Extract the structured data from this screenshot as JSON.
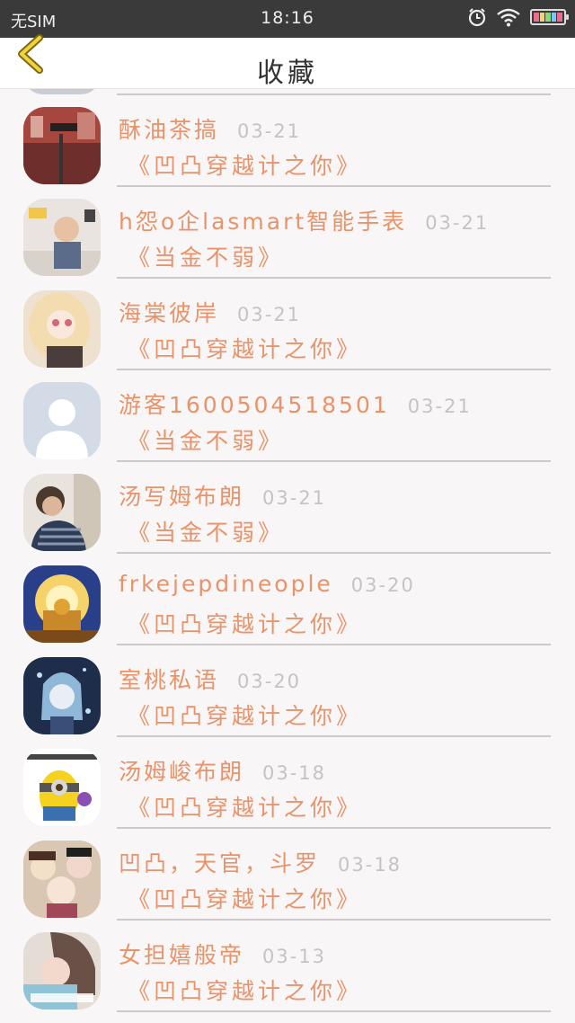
{
  "status_bar": {
    "carrier": "无SIM",
    "time": "18:16"
  },
  "header": {
    "title": "收藏"
  },
  "items": [
    {
      "name": "酥油茶搞",
      "date": "03-21",
      "title": "《凹凸穿越计之你》"
    },
    {
      "name": "h怨o企lasmart智能手表",
      "date": "03-21",
      "title": "《当金不弱》"
    },
    {
      "name": "海棠彼岸",
      "date": "03-21",
      "title": "《凹凸穿越计之你》"
    },
    {
      "name": "游客1600504518501",
      "date": "03-21",
      "title": "《当金不弱》"
    },
    {
      "name": "汤写姆布朗",
      "date": "03-21",
      "title": "《当金不弱》"
    },
    {
      "name": "frkejepdineople",
      "date": "03-20",
      "title": "《凹凸穿越计之你》"
    },
    {
      "name": "室桃私语",
      "date": "03-20",
      "title": "《凹凸穿越计之你》"
    },
    {
      "name": "汤姆峻布朗",
      "date": "03-18",
      "title": "《凹凸穿越计之你》"
    },
    {
      "name": "凹凸，天官，斗罗",
      "date": "03-18",
      "title": "《凹凸穿越计之你》"
    },
    {
      "name": "女担嬉般帝",
      "date": "03-13",
      "title": "《凹凸穿越计之你》"
    }
  ]
}
